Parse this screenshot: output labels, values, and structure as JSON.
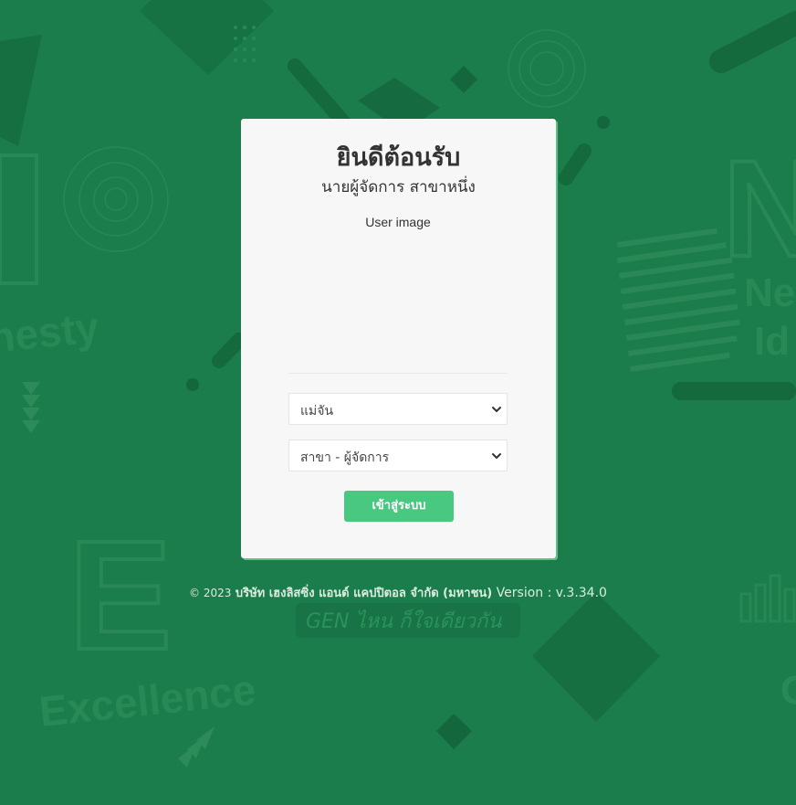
{
  "welcome": {
    "title": "ยินดีต้อนรับ",
    "subtitle": "นายผู้จัดการ สาขาหนึ่ง",
    "user_image_alt": "User image"
  },
  "form": {
    "company_select": {
      "selected": "แม่จัน"
    },
    "branch_select": {
      "selected": "สาขา - ผู้จัดการ"
    },
    "login_button": "เข้าสู่ระบบ"
  },
  "footer": {
    "copyright": "© 2023",
    "company": "บริษัท เฮงลิสซิ่ง แอนด์ แคปปิตอล จำกัด (มหาชน)",
    "version": "Version : v.3.34.0"
  },
  "background_art": {
    "words": [
      "Honesty",
      "Excellence",
      "Ne",
      "Id",
      "GEN ไหน ก็ใจเดียวกัน"
    ],
    "letters": [
      "E",
      "N"
    ]
  },
  "colors": {
    "background": "#1a7d4b",
    "card": "#f7f7f7",
    "button": "#48c881",
    "accent_shadow": "#5fbf86"
  }
}
